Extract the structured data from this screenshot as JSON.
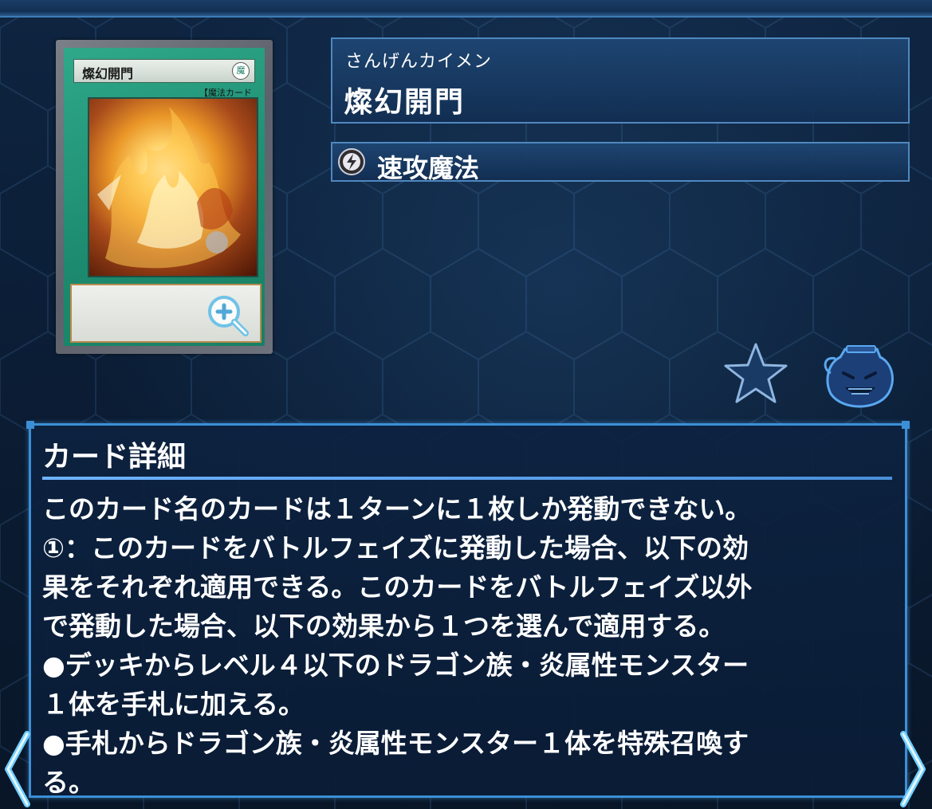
{
  "card": {
    "image_name_text": "燦幻開門",
    "image_attribute_text": "魔",
    "image_type_text": "【魔法カード",
    "image_alt": "燦幻開門 card artwork"
  },
  "header": {
    "name_ruby": "さんげんカイメン",
    "name": "燦幻開門",
    "type_label": "速攻魔法",
    "type_icon": "quick-play-spell-icon"
  },
  "actions": {
    "zoom_icon": "zoom-in-icon",
    "favorite_icon": "star-icon",
    "pot_icon": "pot-of-greed-icon"
  },
  "details": {
    "title": "カード詳細",
    "lines": [
      "このカード名のカードは１ターンに１枚しか発動できない。",
      "①：このカードをバトルフェイズに発動した場合、以下の効",
      "果をそれぞれ適用できる。このカードをバトルフェイズ以外",
      "で発動した場合、以下の効果から１つを選んで適用する。",
      "●デッキからレベル４以下のドラゴン族・炎属性モンスター",
      "１体を手札に加える。",
      "●手札からドラゴン族・炎属性モンスター１体を特殊召喚す",
      "る。"
    ]
  },
  "navigation": {
    "prev_icon": "chevron-left-icon",
    "next_icon": "chevron-right-icon"
  },
  "colors": {
    "accent": "#3c8fd6",
    "panel": "#143056",
    "background": "#0b1d35",
    "card_spell_green": "#1c8a6e"
  }
}
